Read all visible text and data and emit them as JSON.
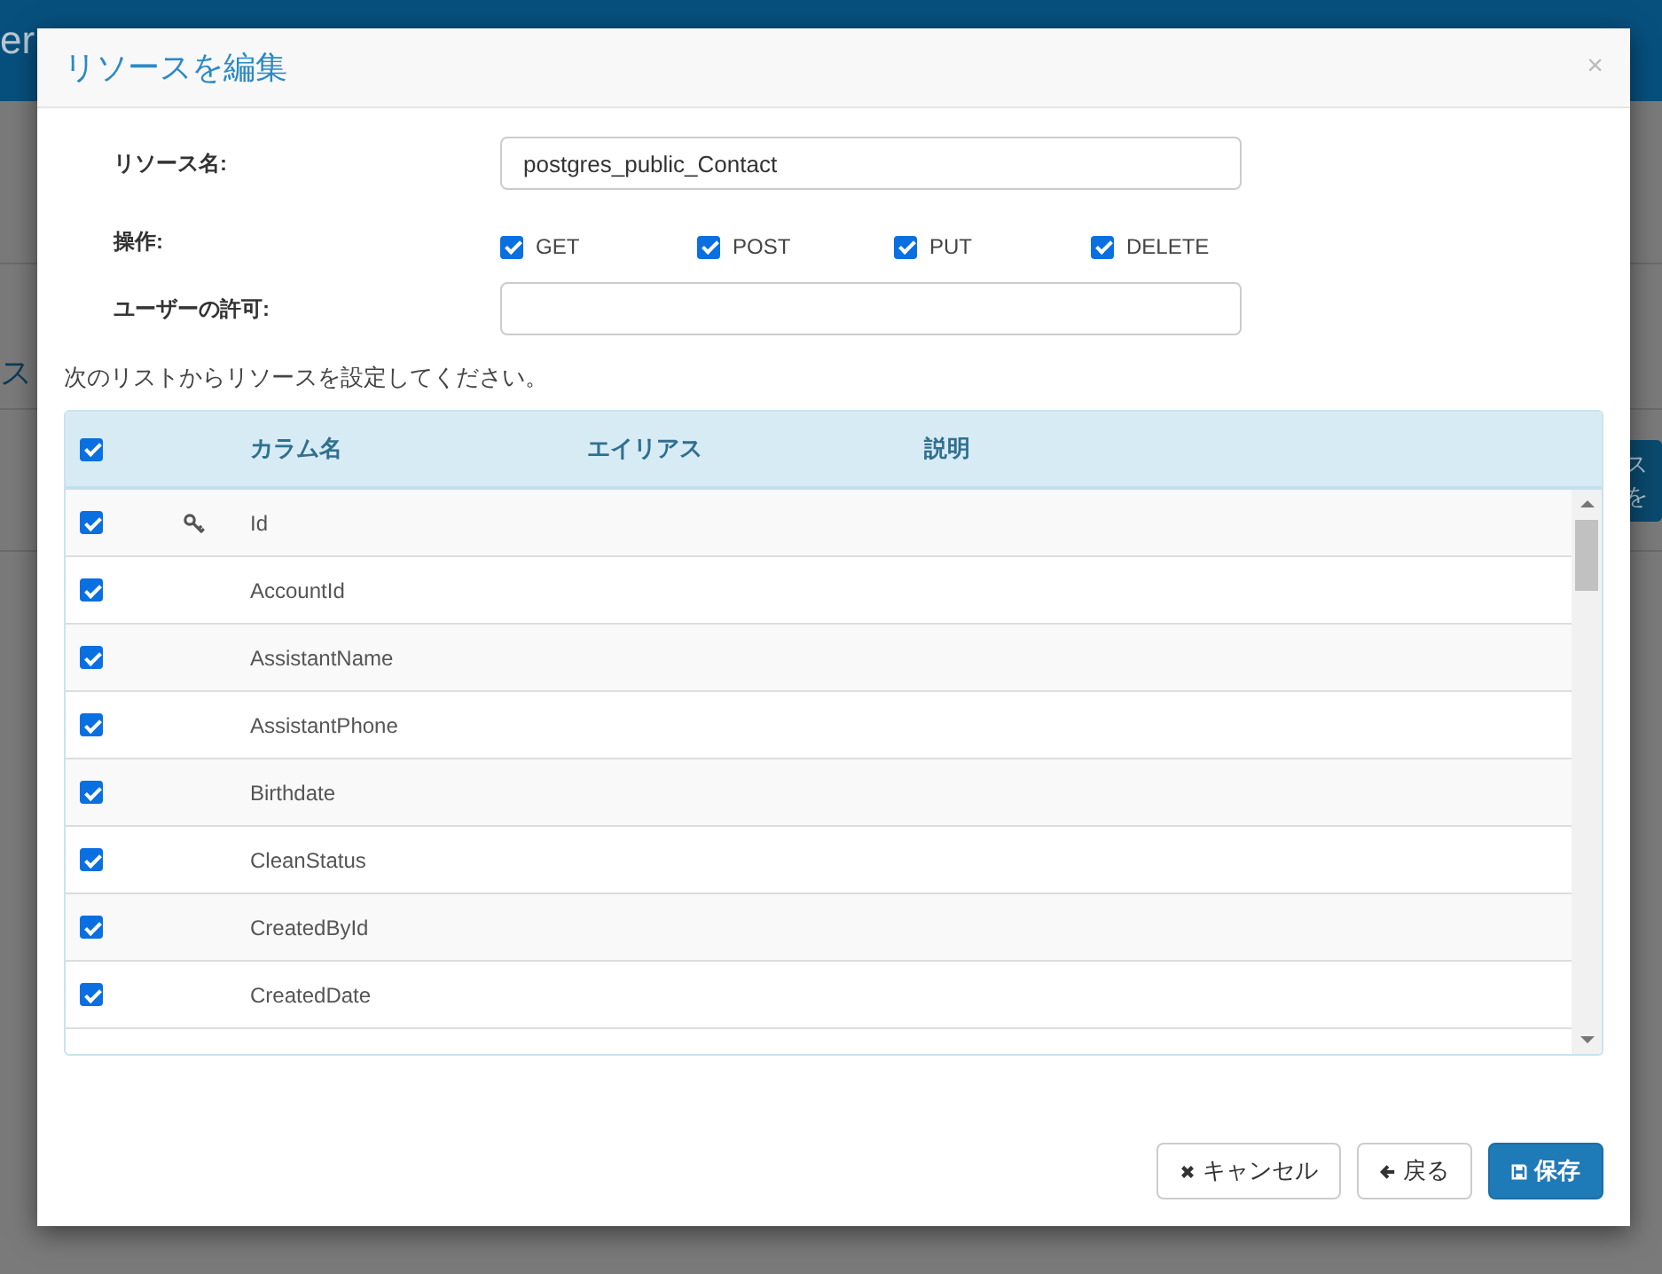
{
  "background": {
    "brand_fragment": "er",
    "side_fragment": "ス",
    "button_fragment": "スを"
  },
  "dialog": {
    "title": "リソースを編集",
    "close": "×"
  },
  "form": {
    "resource_name": {
      "label": "リソース名:",
      "value": "postgres_public_Contact"
    },
    "operations": {
      "label": "操作:",
      "items": [
        {
          "label": "GET",
          "checked": true
        },
        {
          "label": "POST",
          "checked": true
        },
        {
          "label": "PUT",
          "checked": true
        },
        {
          "label": "DELETE",
          "checked": true
        }
      ]
    },
    "user_permission": {
      "label": "ユーザーの許可:"
    }
  },
  "instruction": "次のリストからリソースを設定してください。",
  "table": {
    "all_checked": true,
    "columns": [
      "カラム名",
      "エイリアス",
      "説明"
    ],
    "rows": [
      {
        "checked": true,
        "key": true,
        "name": "Id"
      },
      {
        "checked": true,
        "key": false,
        "name": "AccountId"
      },
      {
        "checked": true,
        "key": false,
        "name": "AssistantName"
      },
      {
        "checked": true,
        "key": false,
        "name": "AssistantPhone"
      },
      {
        "checked": true,
        "key": false,
        "name": "Birthdate"
      },
      {
        "checked": true,
        "key": false,
        "name": "CleanStatus"
      },
      {
        "checked": true,
        "key": false,
        "name": "CreatedById"
      },
      {
        "checked": true,
        "key": false,
        "name": "CreatedDate"
      }
    ]
  },
  "buttons": [
    {
      "kind": "cancel",
      "label": "キャンセル"
    },
    {
      "kind": "back",
      "label": "戻る"
    },
    {
      "kind": "save",
      "label": "保存"
    }
  ]
}
